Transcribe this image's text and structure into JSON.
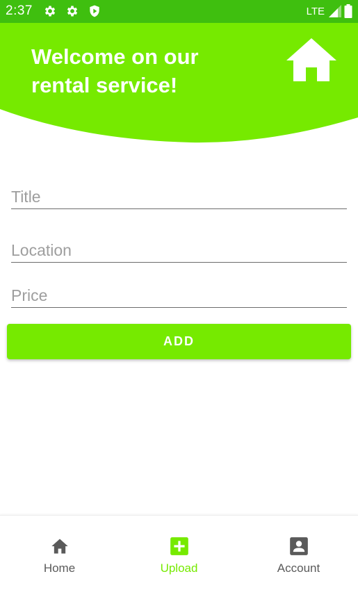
{
  "status_bar": {
    "time": "2:37",
    "network": "LTE",
    "icons": [
      "settings-icon",
      "settings-icon",
      "shield-icon",
      "signal-icon",
      "battery-icon"
    ]
  },
  "header": {
    "title": "Welcome on our rental service!",
    "icon": "home-icon"
  },
  "form": {
    "title_placeholder": "Title",
    "location_placeholder": "Location",
    "price_placeholder": "Price",
    "add_label": "ADD"
  },
  "bottom_nav": {
    "items": [
      {
        "label": "Home",
        "icon": "home-icon",
        "active": false
      },
      {
        "label": "Upload",
        "icon": "add-box-icon",
        "active": true
      },
      {
        "label": "Account",
        "icon": "account-box-icon",
        "active": false
      }
    ]
  },
  "colors": {
    "status_bar": "#3fbf0f",
    "accent": "#76ea00",
    "nav_inactive": "#5a5a5a",
    "placeholder": "#9e9e9e"
  }
}
